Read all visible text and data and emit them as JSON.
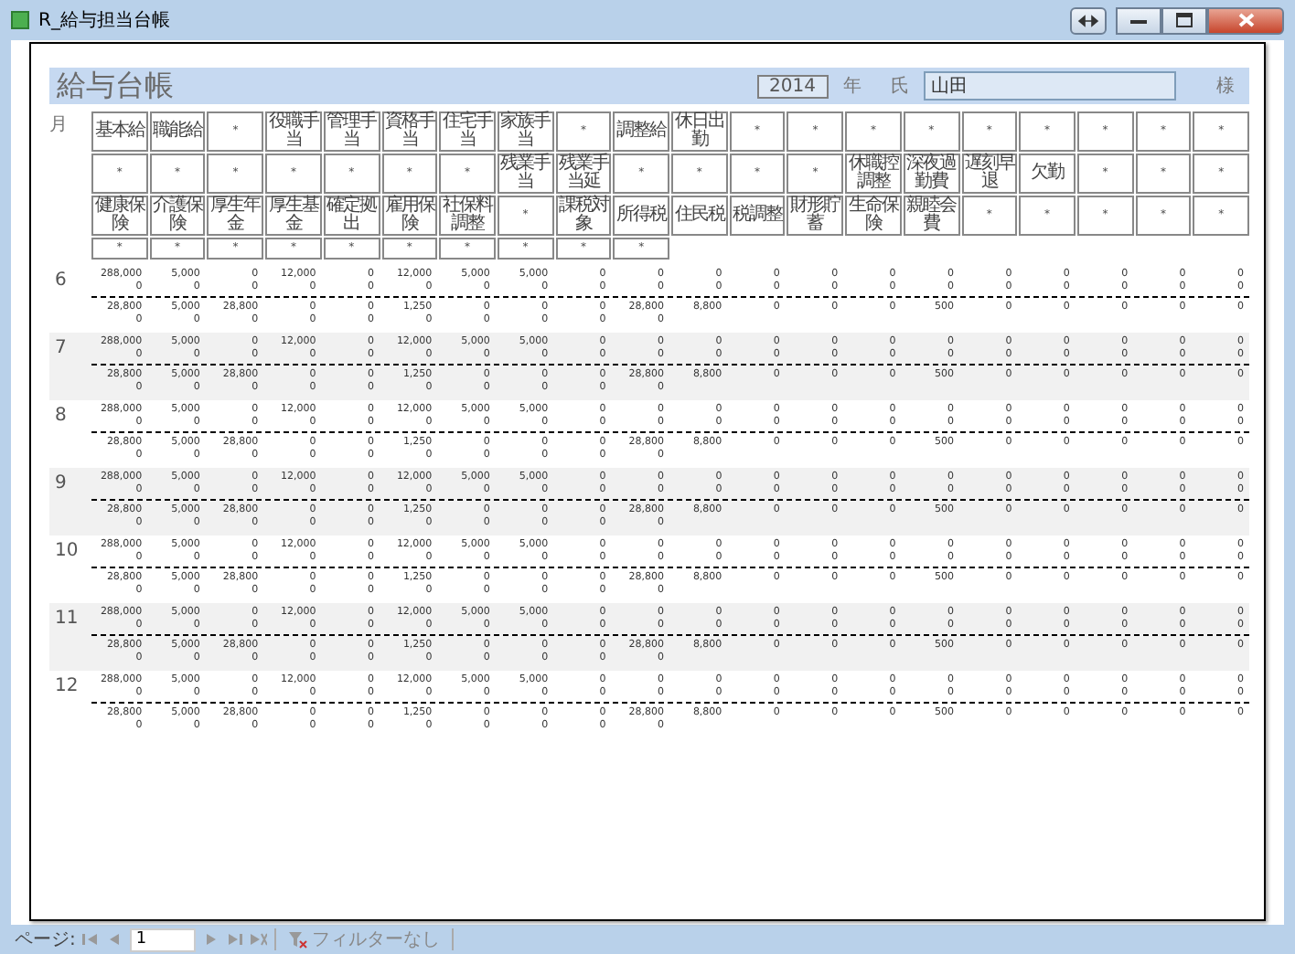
{
  "window": {
    "title": "R_給与担当台帳"
  },
  "report": {
    "title": "給与台帳",
    "year": "2014",
    "year_label": "年",
    "name_label": "氏",
    "name": "山田",
    "honorific": "様",
    "month_header": "月",
    "header_rows": [
      [
        "基本給",
        "職能給",
        "*",
        "役職手当",
        "管理手当",
        "資格手当",
        "住宅手当",
        "家族手当",
        "*",
        "調整給",
        "休日出勤",
        "*",
        "*",
        "*",
        "*",
        "*",
        "*",
        "*",
        "*",
        "*"
      ],
      [
        "*",
        "*",
        "*",
        "*",
        "*",
        "*",
        "*",
        "残業手当",
        "残業手当延",
        "*",
        "*",
        "*",
        "*",
        "休職控調整",
        "深夜過勤費",
        "遅刻早退",
        "欠勤",
        "*",
        "*",
        "*"
      ],
      [
        "健康保険",
        "介護保険",
        "厚生年金",
        "厚生基金",
        "確定拠出",
        "雇用保険",
        "社保料調整",
        "*",
        "課税対象",
        "所得税",
        "住民税",
        "税調整",
        "財形貯蓄",
        "生命保険",
        "親睦会費",
        "*",
        "*",
        "*",
        "*",
        "*"
      ],
      [
        "*",
        "*",
        "*",
        "*",
        "*",
        "*",
        "*",
        "*",
        "*",
        "*"
      ]
    ],
    "months": [
      {
        "month": "6",
        "lines": [
          [
            "288,000",
            "5,000",
            "0",
            "12,000",
            "0",
            "12,000",
            "5,000",
            "5,000",
            "0",
            "0",
            "0",
            "0",
            "0",
            "0",
            "0",
            "0",
            "0",
            "0",
            "0",
            "0"
          ],
          [
            "0",
            "0",
            "0",
            "0",
            "0",
            "0",
            "0",
            "0",
            "0",
            "0",
            "0",
            "0",
            "0",
            "0",
            "0",
            "0",
            "0",
            "0",
            "0",
            "0"
          ],
          [
            "28,800",
            "5,000",
            "28,800",
            "0",
            "0",
            "1,250",
            "0",
            "0",
            "0",
            "28,800",
            "8,800",
            "0",
            "0",
            "0",
            "500",
            "0",
            "0",
            "0",
            "0",
            "0"
          ],
          [
            "0",
            "0",
            "0",
            "0",
            "0",
            "0",
            "0",
            "0",
            "0",
            "0"
          ]
        ]
      },
      {
        "month": "7",
        "lines": [
          [
            "288,000",
            "5,000",
            "0",
            "12,000",
            "0",
            "12,000",
            "5,000",
            "5,000",
            "0",
            "0",
            "0",
            "0",
            "0",
            "0",
            "0",
            "0",
            "0",
            "0",
            "0",
            "0"
          ],
          [
            "0",
            "0",
            "0",
            "0",
            "0",
            "0",
            "0",
            "0",
            "0",
            "0",
            "0",
            "0",
            "0",
            "0",
            "0",
            "0",
            "0",
            "0",
            "0",
            "0"
          ],
          [
            "28,800",
            "5,000",
            "28,800",
            "0",
            "0",
            "1,250",
            "0",
            "0",
            "0",
            "28,800",
            "8,800",
            "0",
            "0",
            "0",
            "500",
            "0",
            "0",
            "0",
            "0",
            "0"
          ],
          [
            "0",
            "0",
            "0",
            "0",
            "0",
            "0",
            "0",
            "0",
            "0",
            "0"
          ]
        ]
      },
      {
        "month": "8",
        "lines": [
          [
            "288,000",
            "5,000",
            "0",
            "12,000",
            "0",
            "12,000",
            "5,000",
            "5,000",
            "0",
            "0",
            "0",
            "0",
            "0",
            "0",
            "0",
            "0",
            "0",
            "0",
            "0",
            "0"
          ],
          [
            "0",
            "0",
            "0",
            "0",
            "0",
            "0",
            "0",
            "0",
            "0",
            "0",
            "0",
            "0",
            "0",
            "0",
            "0",
            "0",
            "0",
            "0",
            "0",
            "0"
          ],
          [
            "28,800",
            "5,000",
            "28,800",
            "0",
            "0",
            "1,250",
            "0",
            "0",
            "0",
            "28,800",
            "8,800",
            "0",
            "0",
            "0",
            "500",
            "0",
            "0",
            "0",
            "0",
            "0"
          ],
          [
            "0",
            "0",
            "0",
            "0",
            "0",
            "0",
            "0",
            "0",
            "0",
            "0"
          ]
        ]
      },
      {
        "month": "9",
        "lines": [
          [
            "288,000",
            "5,000",
            "0",
            "12,000",
            "0",
            "12,000",
            "5,000",
            "5,000",
            "0",
            "0",
            "0",
            "0",
            "0",
            "0",
            "0",
            "0",
            "0",
            "0",
            "0",
            "0"
          ],
          [
            "0",
            "0",
            "0",
            "0",
            "0",
            "0",
            "0",
            "0",
            "0",
            "0",
            "0",
            "0",
            "0",
            "0",
            "0",
            "0",
            "0",
            "0",
            "0",
            "0"
          ],
          [
            "28,800",
            "5,000",
            "28,800",
            "0",
            "0",
            "1,250",
            "0",
            "0",
            "0",
            "28,800",
            "8,800",
            "0",
            "0",
            "0",
            "500",
            "0",
            "0",
            "0",
            "0",
            "0"
          ],
          [
            "0",
            "0",
            "0",
            "0",
            "0",
            "0",
            "0",
            "0",
            "0",
            "0"
          ]
        ]
      },
      {
        "month": "10",
        "lines": [
          [
            "288,000",
            "5,000",
            "0",
            "12,000",
            "0",
            "12,000",
            "5,000",
            "5,000",
            "0",
            "0",
            "0",
            "0",
            "0",
            "0",
            "0",
            "0",
            "0",
            "0",
            "0",
            "0"
          ],
          [
            "0",
            "0",
            "0",
            "0",
            "0",
            "0",
            "0",
            "0",
            "0",
            "0",
            "0",
            "0",
            "0",
            "0",
            "0",
            "0",
            "0",
            "0",
            "0",
            "0"
          ],
          [
            "28,800",
            "5,000",
            "28,800",
            "0",
            "0",
            "1,250",
            "0",
            "0",
            "0",
            "28,800",
            "8,800",
            "0",
            "0",
            "0",
            "500",
            "0",
            "0",
            "0",
            "0",
            "0"
          ],
          [
            "0",
            "0",
            "0",
            "0",
            "0",
            "0",
            "0",
            "0",
            "0",
            "0"
          ]
        ]
      },
      {
        "month": "11",
        "lines": [
          [
            "288,000",
            "5,000",
            "0",
            "12,000",
            "0",
            "12,000",
            "5,000",
            "5,000",
            "0",
            "0",
            "0",
            "0",
            "0",
            "0",
            "0",
            "0",
            "0",
            "0",
            "0",
            "0"
          ],
          [
            "0",
            "0",
            "0",
            "0",
            "0",
            "0",
            "0",
            "0",
            "0",
            "0",
            "0",
            "0",
            "0",
            "0",
            "0",
            "0",
            "0",
            "0",
            "0",
            "0"
          ],
          [
            "28,800",
            "5,000",
            "28,800",
            "0",
            "0",
            "1,250",
            "0",
            "0",
            "0",
            "28,800",
            "8,800",
            "0",
            "0",
            "0",
            "500",
            "0",
            "0",
            "0",
            "0",
            "0"
          ],
          [
            "0",
            "0",
            "0",
            "0",
            "0",
            "0",
            "0",
            "0",
            "0",
            "0"
          ]
        ]
      },
      {
        "month": "12",
        "lines": [
          [
            "288,000",
            "5,000",
            "0",
            "12,000",
            "0",
            "12,000",
            "5,000",
            "5,000",
            "0",
            "0",
            "0",
            "0",
            "0",
            "0",
            "0",
            "0",
            "0",
            "0",
            "0",
            "0"
          ],
          [
            "0",
            "0",
            "0",
            "0",
            "0",
            "0",
            "0",
            "0",
            "0",
            "0",
            "0",
            "0",
            "0",
            "0",
            "0",
            "0",
            "0",
            "0",
            "0",
            "0"
          ],
          [
            "28,800",
            "5,000",
            "28,800",
            "0",
            "0",
            "1,250",
            "0",
            "0",
            "0",
            "28,800",
            "8,800",
            "0",
            "0",
            "0",
            "500",
            "0",
            "0",
            "0",
            "0",
            "0"
          ],
          [
            "0",
            "0",
            "0",
            "0",
            "0",
            "0",
            "0",
            "0",
            "0",
            "0"
          ]
        ]
      }
    ]
  },
  "status_bar": {
    "page_label": "ページ:",
    "page": "1",
    "filter": "フィルターなし"
  }
}
